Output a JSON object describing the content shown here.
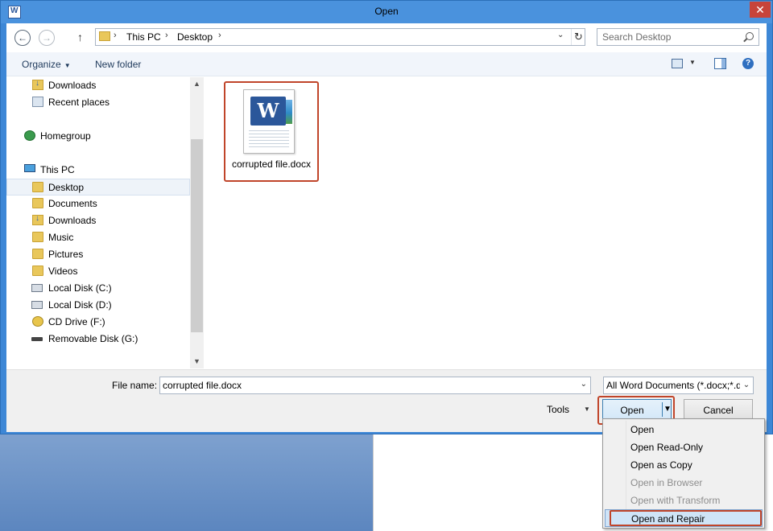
{
  "window": {
    "title": "Open",
    "close_glyph": "✕"
  },
  "nav": {
    "back_glyph": "←",
    "forward_glyph": "→",
    "up_glyph": "↑",
    "breadcrumb": [
      "This PC",
      "Desktop"
    ],
    "sep_glyph": "›",
    "dropdown_glyph": "⌄",
    "refresh_glyph": "↻",
    "search_placeholder": "Search Desktop"
  },
  "toolbar": {
    "organize_label": "Organize",
    "new_folder_label": "New folder",
    "help_glyph": "?",
    "caret_glyph": "▼"
  },
  "tree": [
    {
      "label": "Downloads",
      "icon": "download-folder-icon"
    },
    {
      "label": "Recent places",
      "icon": "recent-places-icon"
    },
    {
      "label": "Homegroup",
      "icon": "homegroup-icon"
    },
    {
      "label": "This PC",
      "icon": "computer-icon"
    },
    {
      "label": "Desktop",
      "icon": "folder-icon",
      "selected": true
    },
    {
      "label": "Documents",
      "icon": "folder-icon"
    },
    {
      "label": "Downloads",
      "icon": "download-folder-icon"
    },
    {
      "label": "Music",
      "icon": "folder-icon"
    },
    {
      "label": "Pictures",
      "icon": "folder-icon"
    },
    {
      "label": "Videos",
      "icon": "folder-icon"
    },
    {
      "label": "Local Disk (C:)",
      "icon": "system-disk-icon"
    },
    {
      "label": "Local Disk (D:)",
      "icon": "disk-icon"
    },
    {
      "label": "CD Drive (F:)",
      "icon": "cd-drive-icon"
    },
    {
      "label": "Removable Disk (G:)",
      "icon": "removable-disk-icon"
    }
  ],
  "scroll": {
    "up_glyph": "▲",
    "down_glyph": "▼"
  },
  "files": [
    {
      "name": "corrupted file.docx",
      "icon": "word-document-icon",
      "badge": "W"
    }
  ],
  "bottom": {
    "file_name_label": "File name:",
    "file_name_value": "corrupted file.docx",
    "filter_value": "All Word Documents (*.docx;*.docm;*.dotx",
    "tools_label": "Tools",
    "open_label": "Open",
    "cancel_label": "Cancel",
    "drop_glyph": "⌄"
  },
  "open_menu": [
    {
      "label": "Open",
      "disabled": false
    },
    {
      "label": "Open Read-Only",
      "disabled": false
    },
    {
      "label": "Open as Copy",
      "disabled": false
    },
    {
      "label": "Open in Browser",
      "disabled": true
    },
    {
      "label": "Open with Transform",
      "disabled": true
    },
    {
      "label": "Open and Repair",
      "disabled": false,
      "hover": true
    }
  ],
  "colors": {
    "titlebar": "#4a92dd",
    "close": "#c7443a",
    "highlight_box": "#c0452a",
    "word_blue": "#2b579a"
  }
}
